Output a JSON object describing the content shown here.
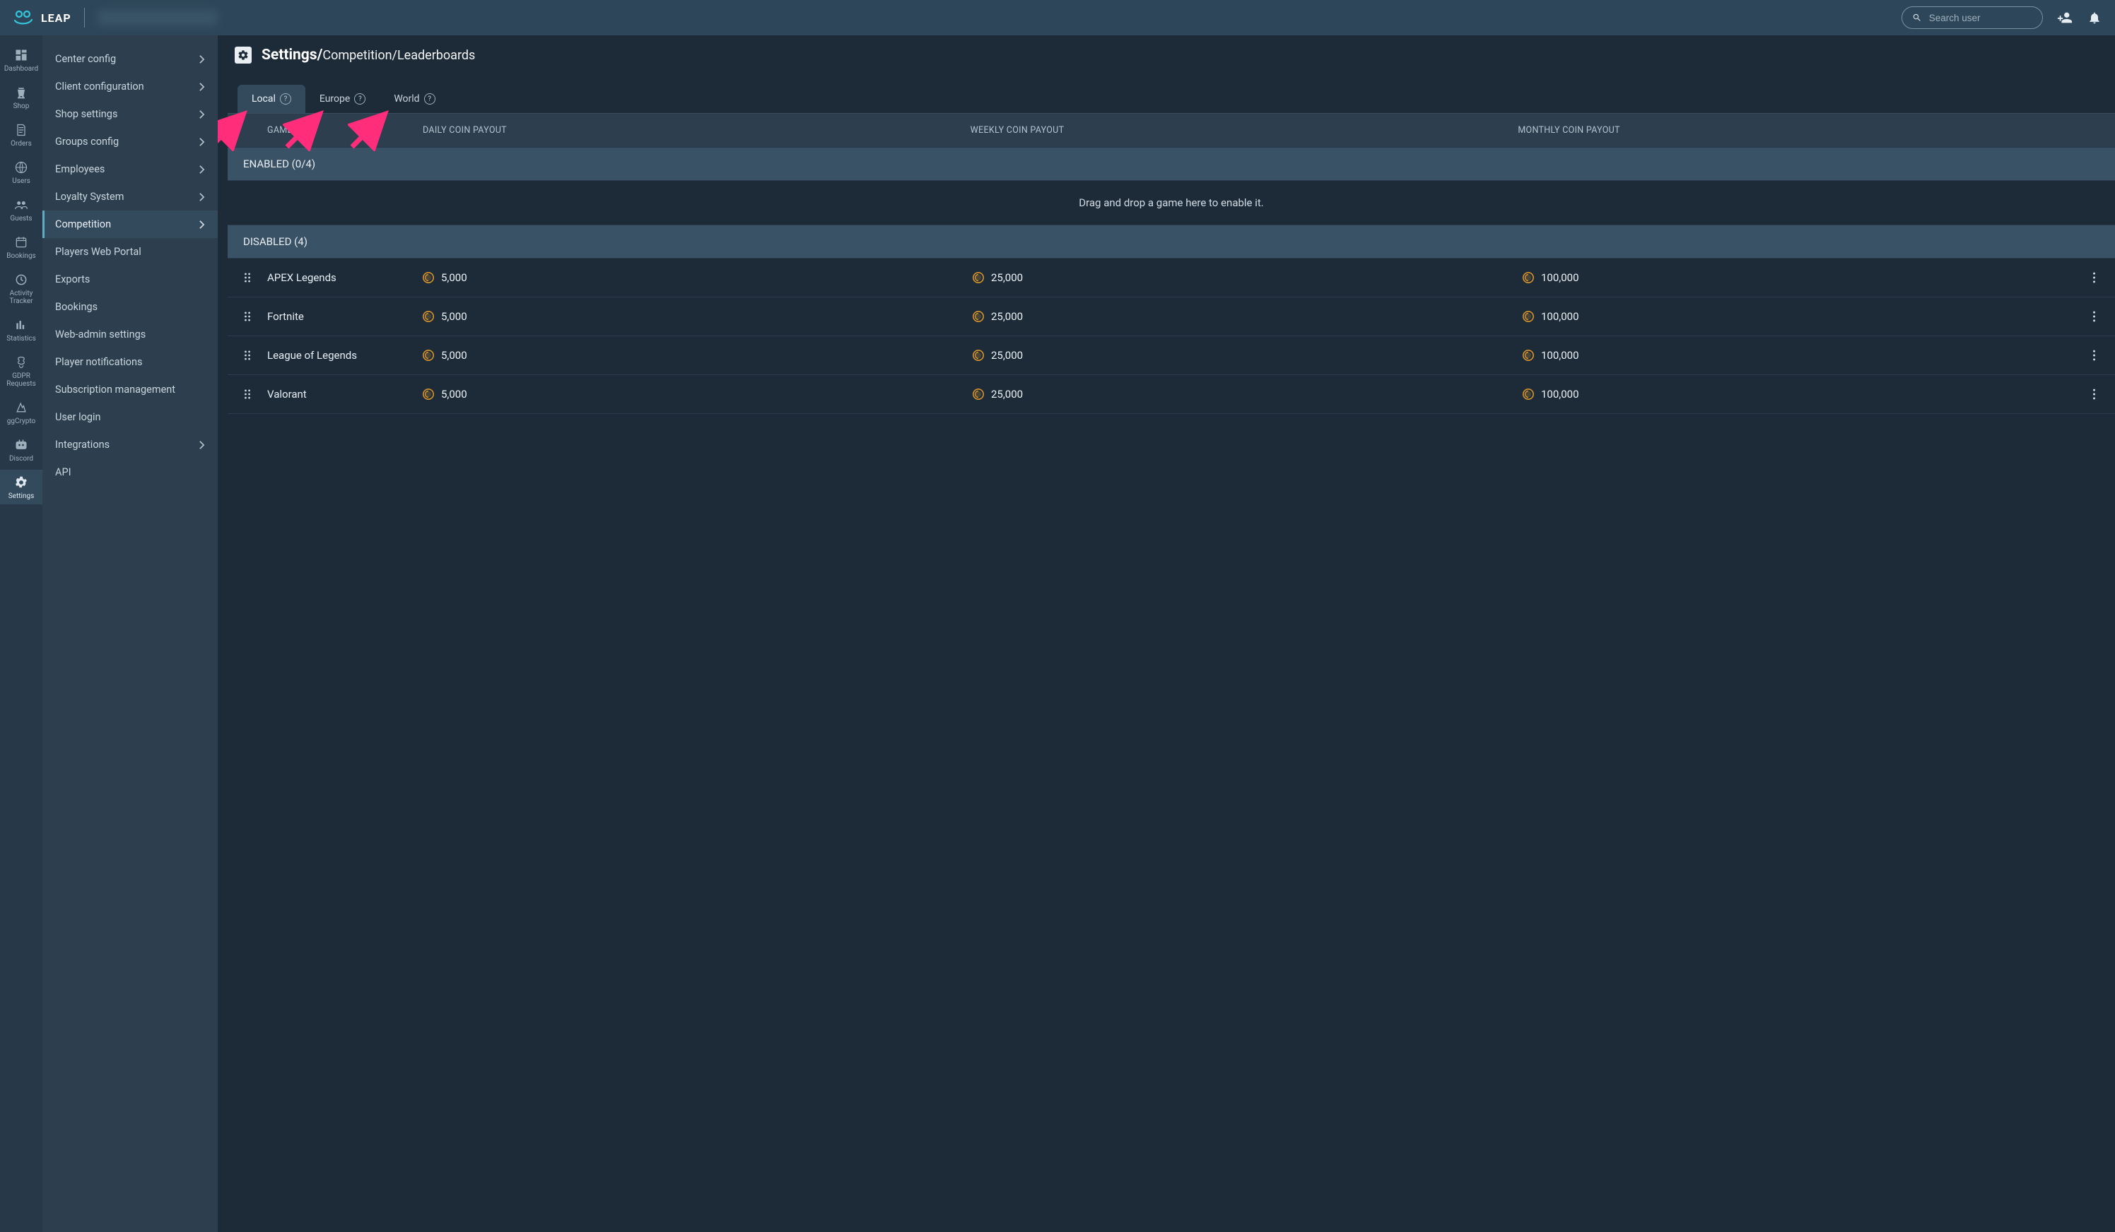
{
  "topbar": {
    "brand": "LEAP",
    "search_placeholder": "Search user"
  },
  "rail": {
    "items": [
      {
        "label": "Dashboard"
      },
      {
        "label": "Shop"
      },
      {
        "label": "Orders"
      },
      {
        "label": "Users"
      },
      {
        "label": "Guests"
      },
      {
        "label": "Bookings"
      },
      {
        "label": "Activity Tracker"
      },
      {
        "label": "Statistics"
      },
      {
        "label": "GDPR Requests"
      },
      {
        "label": "ggCrypto"
      },
      {
        "label": "Discord"
      },
      {
        "label": "Settings"
      }
    ]
  },
  "subside": {
    "items": [
      {
        "label": "Center config",
        "expandable": true
      },
      {
        "label": "Client configuration",
        "expandable": true
      },
      {
        "label": "Shop settings",
        "expandable": true
      },
      {
        "label": "Groups config",
        "expandable": true
      },
      {
        "label": "Employees",
        "expandable": true
      },
      {
        "label": "Loyalty System",
        "expandable": true
      },
      {
        "label": "Competition",
        "expandable": true,
        "active": true
      },
      {
        "label": "Players Web Portal",
        "expandable": false
      },
      {
        "label": "Exports",
        "expandable": false
      },
      {
        "label": "Bookings",
        "expandable": false
      },
      {
        "label": "Web-admin settings",
        "expandable": false
      },
      {
        "label": "Player notifications",
        "expandable": false
      },
      {
        "label": "Subscription management",
        "expandable": false
      },
      {
        "label": "User login",
        "expandable": false
      },
      {
        "label": "Integrations",
        "expandable": true
      },
      {
        "label": "API",
        "expandable": false
      }
    ]
  },
  "breadcrumb": {
    "root": "Settings/",
    "path": "Competition/Leaderboards"
  },
  "tabs": [
    {
      "label": "Local",
      "active": true
    },
    {
      "label": "Europe",
      "active": false
    },
    {
      "label": "World",
      "active": false
    }
  ],
  "columns": {
    "game": "GAME",
    "daily": "DAILY COIN PAYOUT",
    "weekly": "WEEKLY COIN PAYOUT",
    "monthly": "MONTHLY COIN PAYOUT"
  },
  "sections": {
    "enabled_head": "ENABLED (0/4)",
    "drop_hint": "Drag and drop a game here to enable it.",
    "disabled_head": "DISABLED (4)"
  },
  "rows": [
    {
      "game": "APEX Legends",
      "daily": "5,000",
      "weekly": "25,000",
      "monthly": "100,000"
    },
    {
      "game": "Fortnite",
      "daily": "5,000",
      "weekly": "25,000",
      "monthly": "100,000"
    },
    {
      "game": "League of Legends",
      "daily": "5,000",
      "weekly": "25,000",
      "monthly": "100,000"
    },
    {
      "game": "Valorant",
      "daily": "5,000",
      "weekly": "25,000",
      "monthly": "100,000"
    }
  ],
  "annotations": {
    "arrow_color": "#ff2d7a"
  }
}
